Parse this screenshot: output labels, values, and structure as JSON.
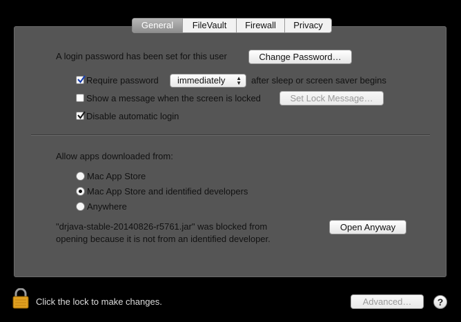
{
  "tabs": [
    {
      "label": "General",
      "active": true
    },
    {
      "label": "FileVault",
      "active": false
    },
    {
      "label": "Firewall",
      "active": false
    },
    {
      "label": "Privacy",
      "active": false
    }
  ],
  "login": {
    "message": "A login password has been set for this user",
    "change_password_label": "Change Password…"
  },
  "options": {
    "require_password_label": "Require password",
    "require_password_checked": true,
    "require_password_delay": "immediately",
    "after_sleep_text": "after sleep or screen saver begins",
    "show_message_label": "Show a message when the screen is locked",
    "show_message_checked": false,
    "set_lock_message_label": "Set Lock Message…",
    "disable_auto_login_label": "Disable automatic login",
    "disable_auto_login_checked": true
  },
  "apps": {
    "heading": "Allow apps downloaded from:",
    "radio_options": [
      {
        "label": "Mac App Store",
        "selected": false
      },
      {
        "label": "Mac App Store and identified developers",
        "selected": true
      },
      {
        "label": "Anywhere",
        "selected": false
      }
    ],
    "blocked_line1": "\"drjava-stable-20140826-r5761.jar\" was blocked from",
    "blocked_line2": "opening because it is not from an identified developer.",
    "open_anyway_label": "Open Anyway"
  },
  "footer": {
    "lock_text": "Click the lock to make changes.",
    "advanced_label": "Advanced…",
    "help_label": "?"
  },
  "colors": {
    "panel": "#555555",
    "window_bg": "#000000",
    "lock_gold": "#e0a020"
  }
}
